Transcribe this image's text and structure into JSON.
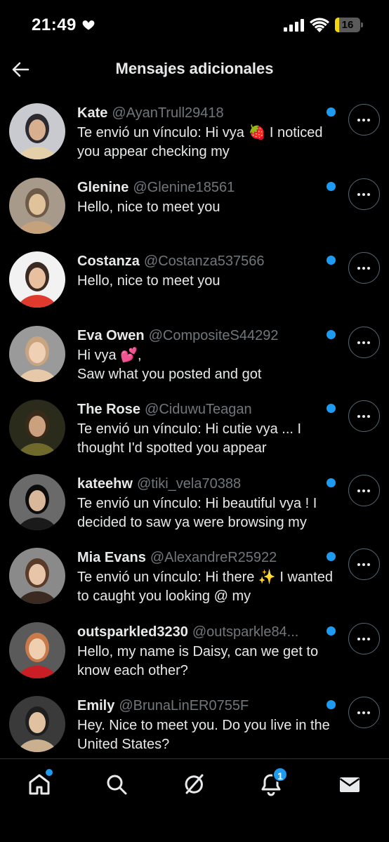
{
  "status_bar": {
    "time": "21:49",
    "battery_level": "16",
    "battery_fraction": 0.16,
    "icons": [
      "heart-icon",
      "signal-icon",
      "wifi-icon",
      "battery-icon"
    ]
  },
  "header": {
    "title": "Mensajes adicionales",
    "back_icon": "arrow-left-icon"
  },
  "colors": {
    "background": "#000000",
    "text": "#e7e9ea",
    "secondary_text": "#71767b",
    "accent": "#1d9bf0",
    "battery": "#f5d60a"
  },
  "messages": [
    {
      "name": "Kate",
      "handle": "@AyanTrull29418",
      "preview": "Te envió un vínculo: Hi vya 🍓 I noticed you appear checking my",
      "unread": true
    },
    {
      "name": "Glenine",
      "handle": "@Glenine18561",
      "preview": "Hello, nice to meet you",
      "unread": true
    },
    {
      "name": "Costanza",
      "handle": "@Costanza537566",
      "preview": "Hello, nice to meet you",
      "unread": true
    },
    {
      "name": "Eva Owen",
      "handle": "@CompositeS44292",
      "preview": "Hi vya 💕,\nSaw what you posted and got",
      "unread": true
    },
    {
      "name": "The Rose",
      "handle": "@CiduwuTeagan",
      "preview": "Te envió un vínculo: Hi cutie vya ... I thought I'd spotted you appear",
      "unread": true
    },
    {
      "name": "kateehw",
      "handle": "@tiki_vela70388",
      "preview": "Te envió un vínculo: Hi beautiful vya ! I decided to saw ya were browsing my",
      "unread": true
    },
    {
      "name": "Mia Evans",
      "handle": "@AlexandreR25922",
      "preview": "Te envió un vínculo: Hi there ✨ I wanted to caught you looking @ my",
      "unread": true
    },
    {
      "name": "outsparkled3230",
      "handle": "@outsparkle84...",
      "preview": "Hello, my name is Daisy, can we get to know each other?",
      "unread": true
    },
    {
      "name": "Emily",
      "handle": "@BrunaLinER0755F",
      "preview": "Hey. Nice to meet you. Do you live in the United States?",
      "unread": true
    }
  ],
  "bottom_nav": {
    "items": [
      {
        "icon": "home-icon",
        "has_dot": true
      },
      {
        "icon": "search-icon"
      },
      {
        "icon": "grok-icon"
      },
      {
        "icon": "bell-icon",
        "badge": "1"
      },
      {
        "icon": "mail-icon"
      }
    ]
  }
}
